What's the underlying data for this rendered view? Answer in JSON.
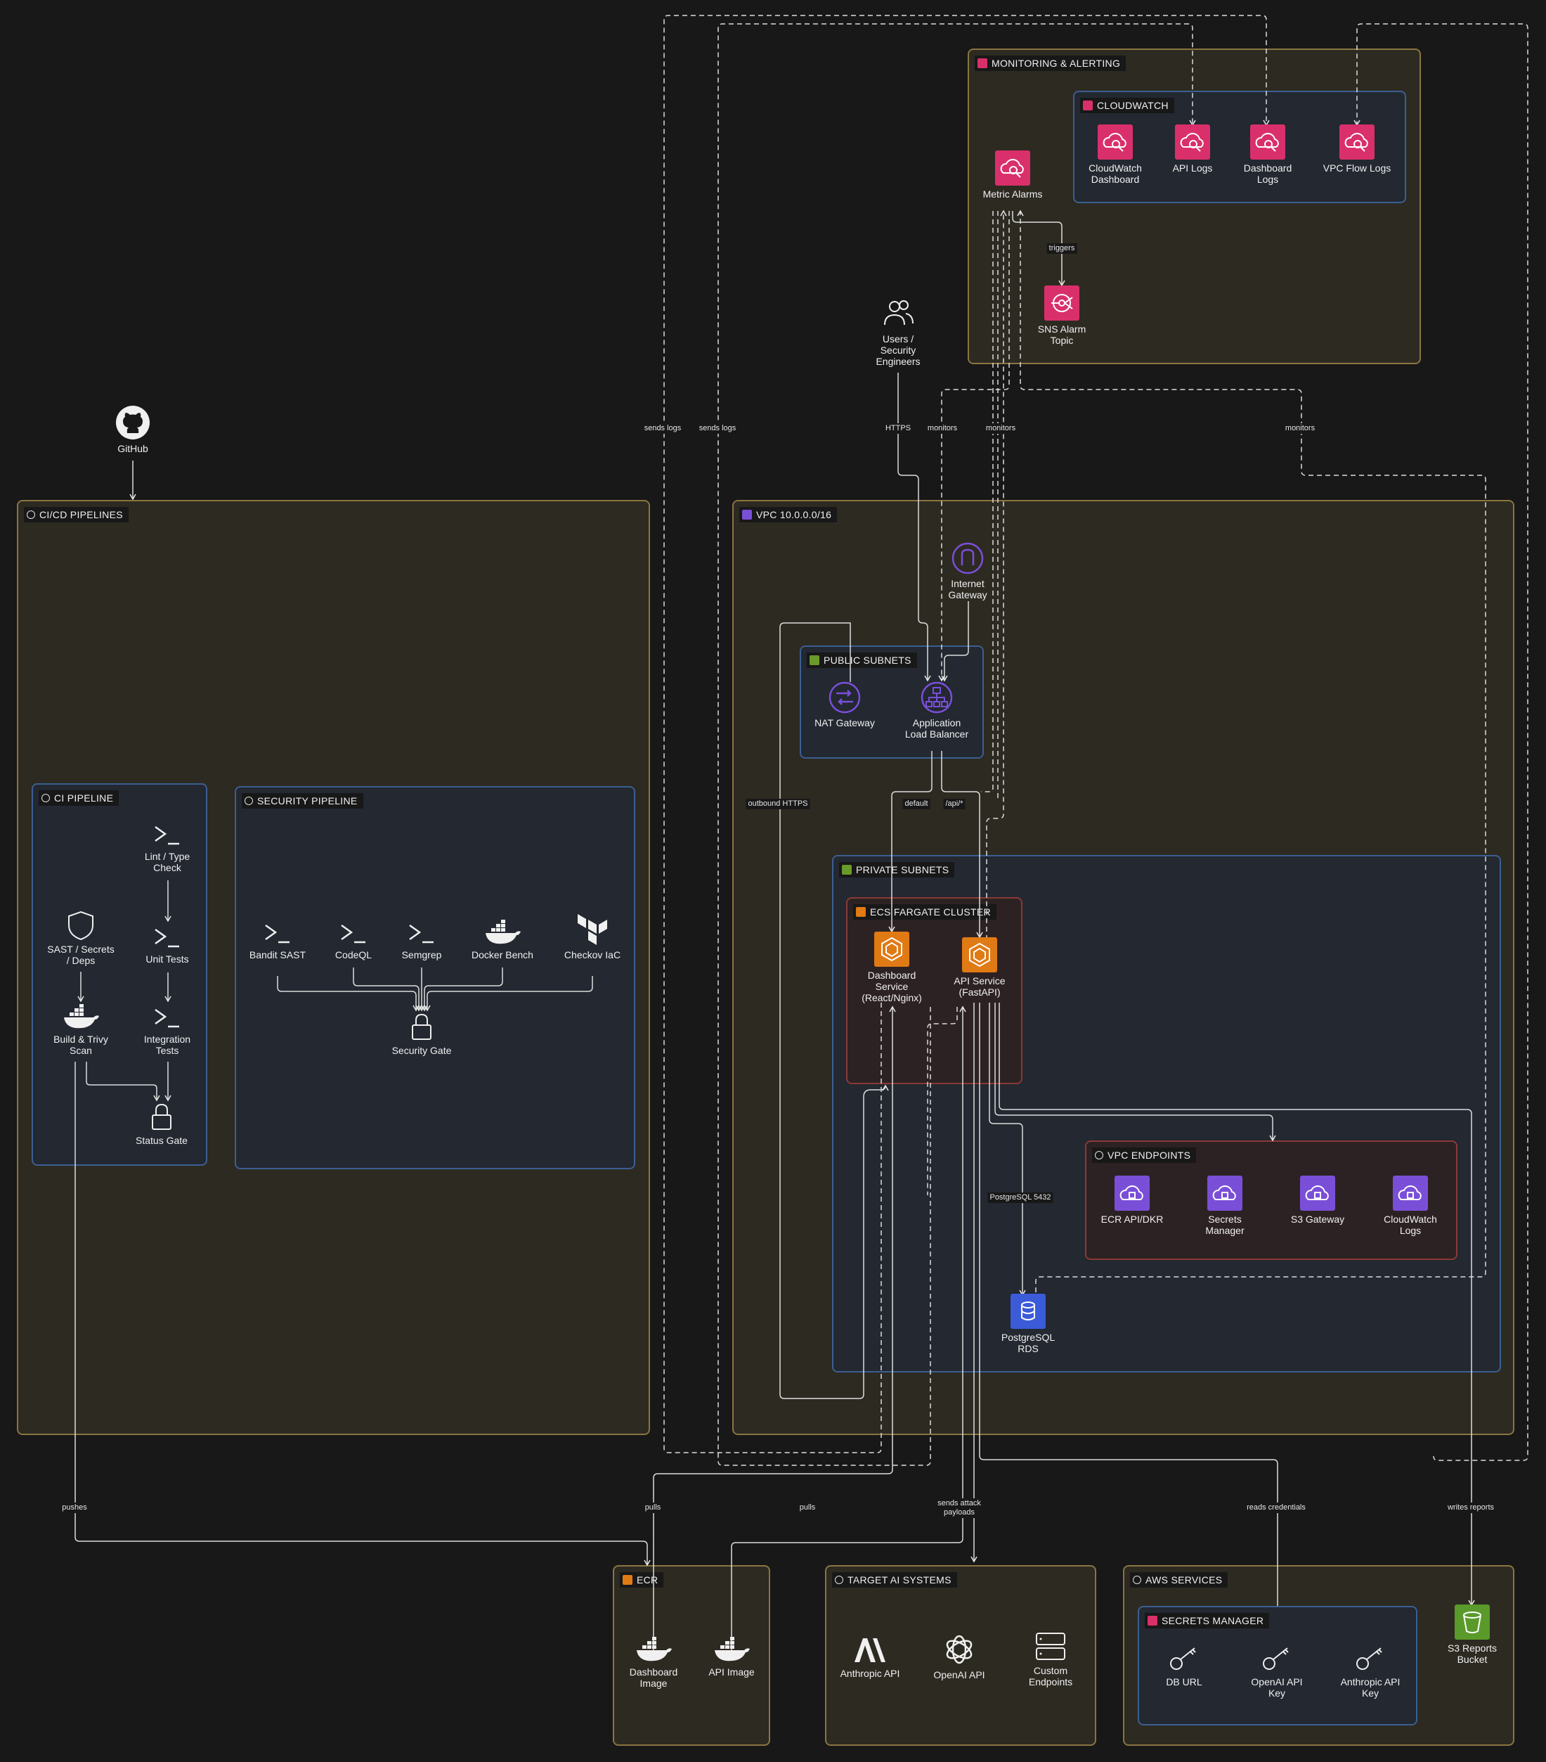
{
  "groups": {
    "monitoring": "MONITORING & ALERTING",
    "cloudwatch": "CLOUDWATCH",
    "cicd": "CI/CD PIPELINES",
    "ci": "CI PIPELINE",
    "security": "SECURITY PIPELINE",
    "vpc": "VPC 10.0.0.0/16",
    "public": "PUBLIC SUBNETS",
    "private": "PRIVATE SUBNETS",
    "ecs": "ECS FARGATE CLUSTER",
    "endpoints": "VPC ENDPOINTS",
    "ecr": "ECR",
    "target": "TARGET AI SYSTEMS",
    "aws": "AWS SERVICES",
    "secrets": "SECRETS MANAGER"
  },
  "nodes": {
    "cw_dashboard": "CloudWatch\nDashboard",
    "api_logs": "API Logs",
    "dashboard_logs": "Dashboard\nLogs",
    "vpc_flow_logs": "VPC Flow Logs",
    "metric_alarms": "Metric Alarms",
    "sns": "SNS Alarm\nTopic",
    "users": "Users /\nSecurity\nEngineers",
    "github": "GitHub",
    "lint": "Lint / Type\nCheck",
    "unit": "Unit Tests",
    "integration": "Integration\nTests",
    "sast": "SAST / Secrets\n/ Deps",
    "build": "Build & Trivy\nScan",
    "status_gate": "Status Gate",
    "bandit": "Bandit SAST",
    "codeql": "CodeQL",
    "semgrep": "Semgrep",
    "docker_bench": "Docker Bench",
    "checkov": "Checkov IaC",
    "security_gate": "Security Gate",
    "igw": "Internet\nGateway",
    "nat": "NAT Gateway",
    "alb": "Application\nLoad Balancer",
    "dashboard_svc": "Dashboard\nService\n(React/Nginx)",
    "api_svc": "API Service\n(FastAPI)",
    "ecr_api": "ECR API/DKR",
    "ep_secrets": "Secrets\nManager",
    "ep_s3": "S3 Gateway",
    "ep_cwlogs": "CloudWatch\nLogs",
    "rds": "PostgreSQL\nRDS",
    "dash_image": "Dashboard\nImage",
    "api_image": "API Image",
    "anthropic": "Anthropic API",
    "openai": "OpenAI API",
    "custom": "Custom\nEndpoints",
    "db_url": "DB URL",
    "openai_key": "OpenAI API\nKey",
    "anthropic_key": "Anthropic API\nKey",
    "s3_reports": "S3 Reports\nBucket"
  },
  "edges": {
    "sends_logs_1": "sends logs",
    "sends_logs_2": "sends logs",
    "https": "HTTPS",
    "monitors_1": "monitors",
    "monitors_2": "monitors",
    "monitors_3": "monitors",
    "triggers": "triggers",
    "outbound": "outbound HTTPS",
    "default": "default",
    "api": "/api/*",
    "postgres": "PostgreSQL 5432",
    "pushes": "pushes",
    "pulls_1": "pulls",
    "pulls_2": "pulls",
    "attack": "sends attack\npayloads",
    "reads_creds": "reads credentials",
    "writes_reports": "writes reports"
  },
  "colors": {
    "pink": "#d9306b",
    "purple": "#7a4fd8",
    "orange": "#e07a14",
    "rds_blue": "#3b5bd9",
    "s3_green": "#5a9a2a"
  }
}
